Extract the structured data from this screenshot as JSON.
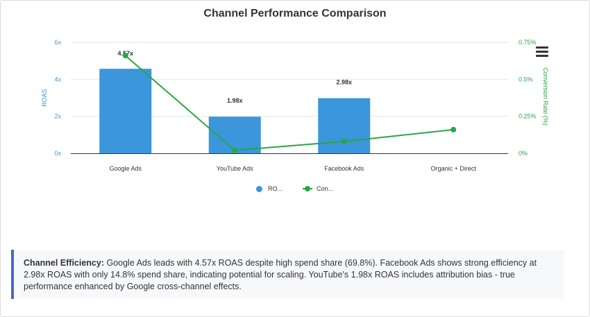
{
  "colors": {
    "roas": "#3b96db",
    "conversion": "#28a745",
    "text": "#333333",
    "axis_left": "#3b96db",
    "axis_right": "#28a745"
  },
  "chart_data": {
    "type": "bar",
    "title": "Channel Performance Comparison",
    "categories": [
      "Google Ads",
      "YouTube Ads",
      "Facebook Ads",
      "Organic + Direct"
    ],
    "series": [
      {
        "name": "RO...",
        "kind": "bar",
        "axis": "left",
        "values": [
          4.57,
          1.98,
          2.98,
          null
        ],
        "labels": [
          "4.57x",
          "1.98x",
          "2.98x",
          ""
        ]
      },
      {
        "name": "Con...",
        "kind": "line",
        "axis": "right",
        "values": [
          0.66,
          0.02,
          0.08,
          0.16
        ]
      }
    ],
    "y_left": {
      "label": "ROAS",
      "range": [
        0,
        6
      ],
      "ticks": [
        0,
        2,
        4,
        6
      ],
      "tick_labels": [
        "0x",
        "2x",
        "4x",
        "6x"
      ]
    },
    "y_right": {
      "label": "Conversion Rate (%)",
      "range": [
        0,
        0.75
      ],
      "ticks": [
        0,
        0.25,
        0.5,
        0.75
      ],
      "tick_labels": [
        "0%",
        "0.25%",
        "0.5%",
        "0.75%"
      ]
    },
    "grid": true,
    "legend": "bottom"
  },
  "insight": {
    "label": "Channel Efficiency:",
    "text": " Google Ads leads with 4.57x ROAS despite high spend share (69.8%). Facebook Ads shows strong efficiency at 2.98x ROAS with only 14.8% spend share, indicating potential for scaling. YouTube's 1.98x ROAS includes attribution bias - true performance enhanced by Google cross-channel effects."
  },
  "icons": {
    "menu": "hamburger-menu-icon"
  }
}
